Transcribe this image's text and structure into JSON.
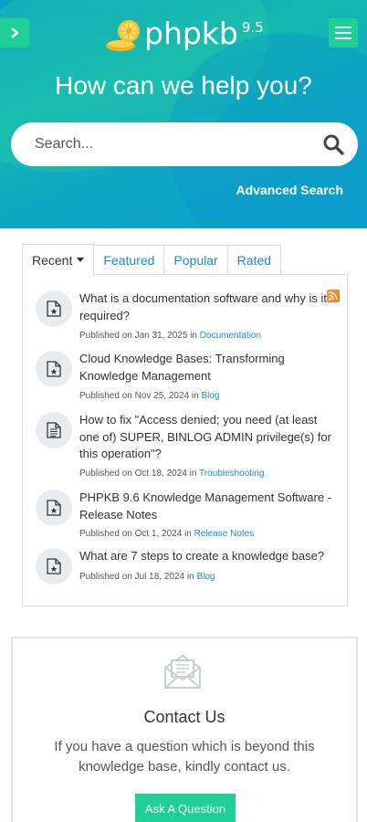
{
  "header": {
    "brand": "phpkb",
    "version": "9.5",
    "hero_title": "How can we help you?",
    "search_placeholder": "Search...",
    "advanced_search": "Advanced Search",
    "icons": [
      "chevron-right-icon",
      "menu-icon",
      "search-icon",
      "logo-icon"
    ],
    "accent_color": "#1fcf98"
  },
  "tabs": [
    {
      "label": "Recent",
      "active": true
    },
    {
      "label": "Featured",
      "active": false
    },
    {
      "label": "Popular",
      "active": false
    },
    {
      "label": "Rated",
      "active": false
    }
  ],
  "articles": [
    {
      "title": "What is a documentation software and why is it required?",
      "published": "Published on Jan 31, 2025 in",
      "category": "Documentation"
    },
    {
      "title": "Cloud Knowledge Bases: Transforming Knowledge Management",
      "published": "Published on Nov 25, 2024 in",
      "category": "Blog"
    },
    {
      "title": "How to fix \"Access denied; you need (at least one of) SUPER, BINLOG ADMIN privilege(s) for this operation\"?",
      "published": "Published on Oct 18, 2024 in",
      "category": "Troubleshooting"
    },
    {
      "title": "PHPKB 9.6 Knowledge Management Software - Release Notes",
      "published": "Published on Oct 1, 2024 in",
      "category": "Release Notes"
    },
    {
      "title": "What are 7 steps to create a knowledge base?",
      "published": "Published on Jul 18, 2024 in",
      "category": "Blog"
    }
  ],
  "contact": {
    "title": "Contact Us",
    "text": "If you have a question which is beyond this knowledge base, kindly contact us.",
    "button": "Ask A Question"
  }
}
